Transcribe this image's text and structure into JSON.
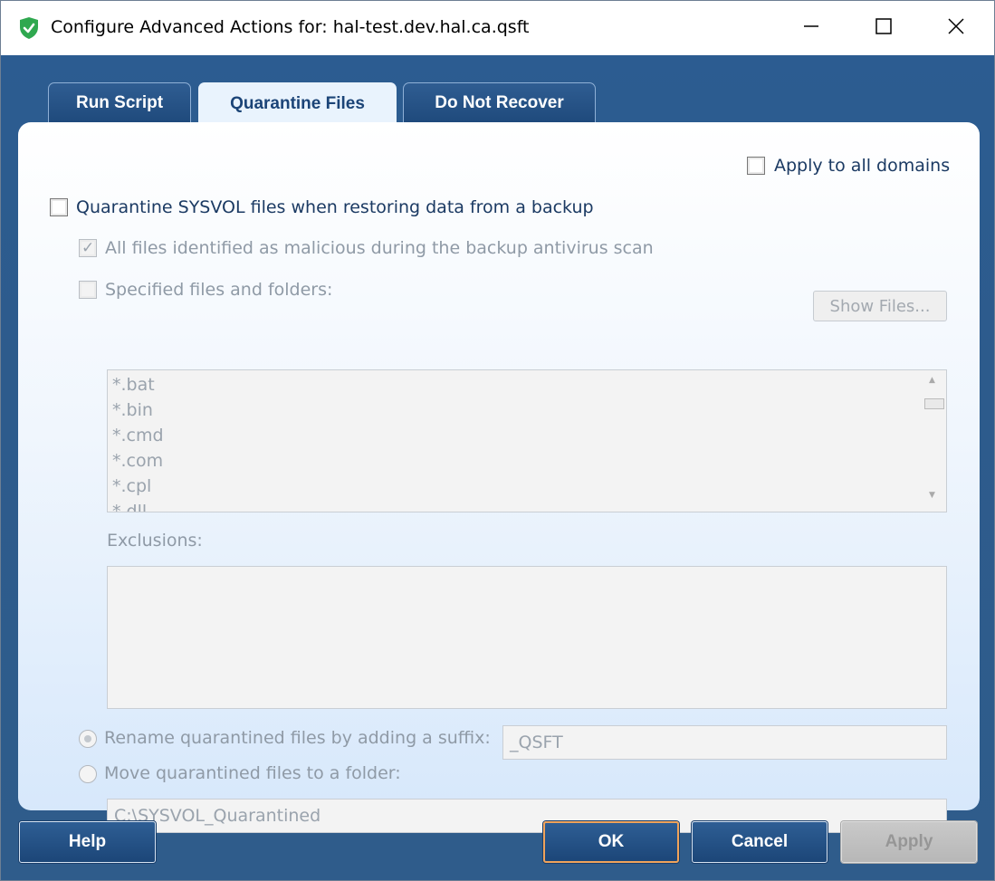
{
  "window": {
    "title": "Configure Advanced Actions for: hal-test.dev.hal.ca.qsft",
    "icon": "shield-check-icon",
    "controls": [
      "minimize-icon",
      "maximize-icon",
      "close-icon"
    ]
  },
  "tabs": [
    {
      "label": "Run Script",
      "active": false
    },
    {
      "label": "Quarantine Files",
      "active": true
    },
    {
      "label": "Do Not Recover",
      "active": false
    }
  ],
  "panel": {
    "apply_all_domains": {
      "label": "Apply to all domains",
      "checked": false
    },
    "quarantine_sysvol": {
      "label": "Quarantine SYSVOL files when restoring data from a backup",
      "checked": false
    },
    "malicious_files": {
      "label": "All files identified as malicious during the backup antivirus scan",
      "checked": true,
      "enabled": false
    },
    "show_files_button": "Show Files...",
    "specified_files": {
      "label": "Specified files and folders:",
      "checked": false,
      "enabled": false
    },
    "file_patterns": [
      "*.bat",
      "*.bin",
      "*.cmd",
      "*.com",
      "*.cpl",
      "*.dll"
    ],
    "exclusions_label": "Exclusions:",
    "exclusions": [],
    "rename_option": {
      "label": "Rename quarantined files by adding a suffix:",
      "selected": true,
      "enabled": false
    },
    "suffix_value": "_QSFT",
    "move_option": {
      "label": "Move quarantined files to a folder:",
      "selected": false,
      "enabled": false
    },
    "folder_value": "C:\\SYSVOL_Quarantined"
  },
  "buttons": {
    "help": "Help",
    "ok": "OK",
    "cancel": "Cancel",
    "apply": "Apply"
  },
  "colors": {
    "frame": "#2f5d8f",
    "accent_ok_border": "#f0a35a",
    "shield": "#2fa84f"
  }
}
